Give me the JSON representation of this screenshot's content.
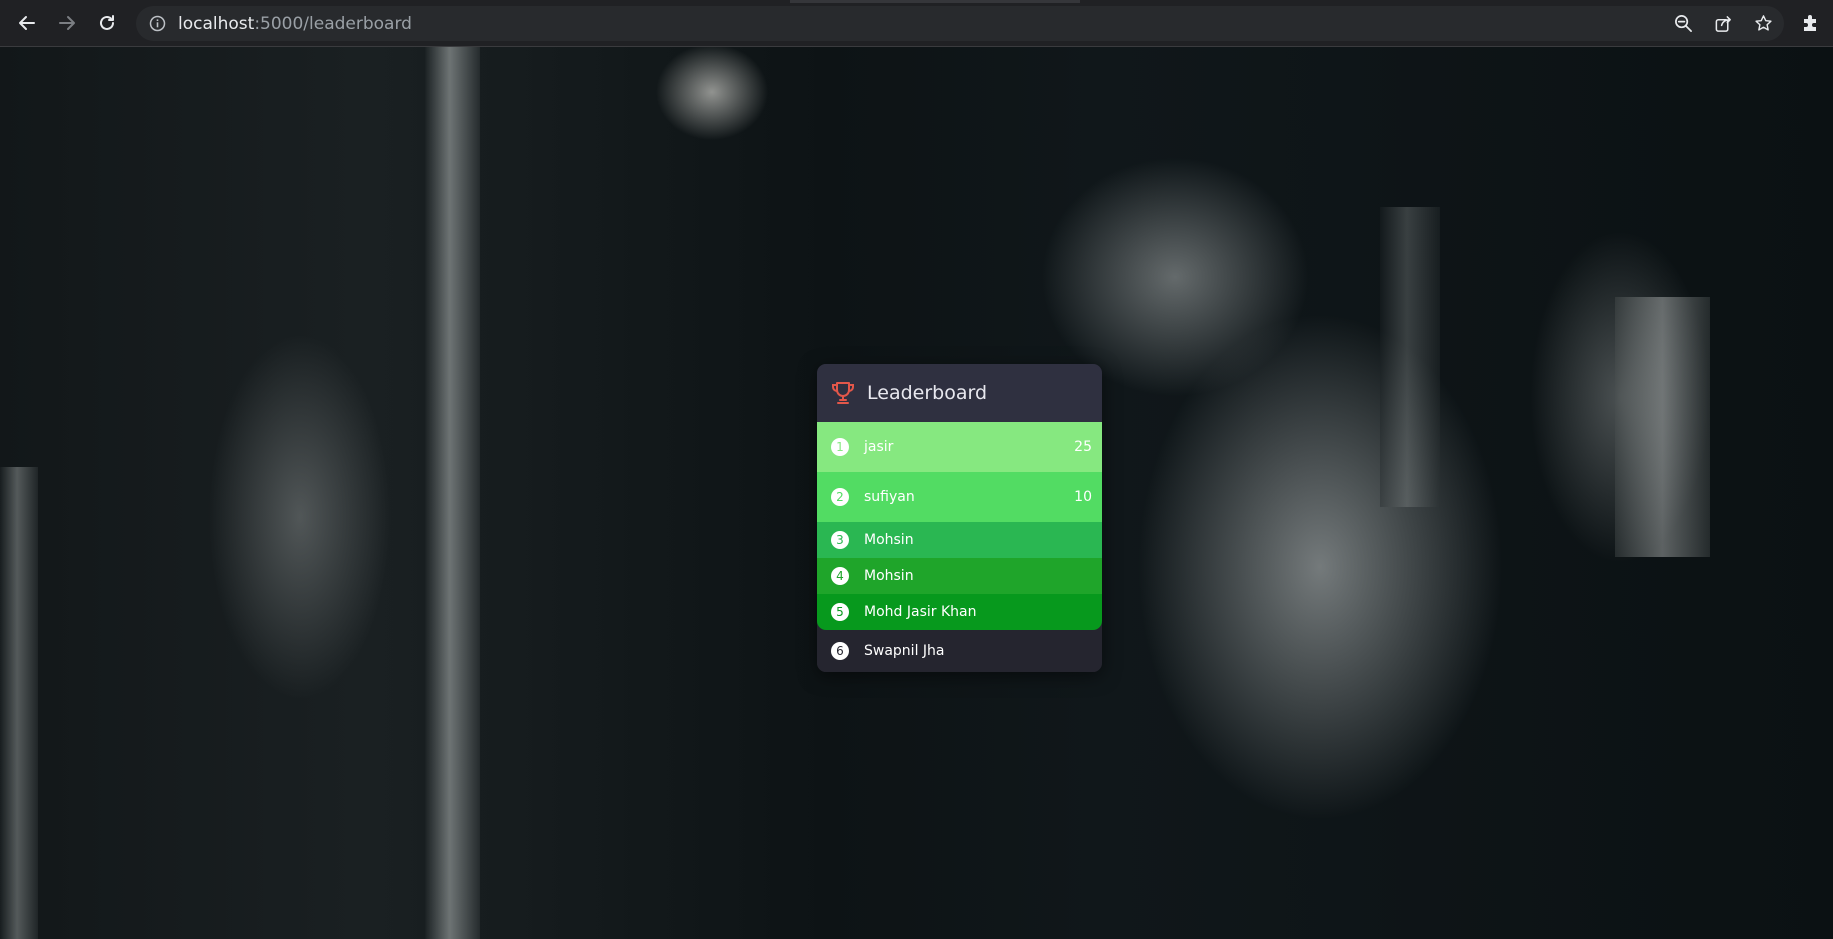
{
  "browser": {
    "url_host": "localhost",
    "url_rest": ":5000/leaderboard"
  },
  "leaderboard": {
    "title": "Leaderboard",
    "entries": [
      {
        "rank": "1",
        "name": "jasir",
        "score": "25",
        "color": "#86e880",
        "rank_color": "#86e880"
      },
      {
        "rank": "2",
        "name": "sufiyan",
        "score": "10",
        "color": "#52dc63",
        "rank_color": "#52dc63"
      },
      {
        "rank": "3",
        "name": "Mohsin",
        "score": "",
        "color": "#2ab752",
        "rank_color": "#2ab752"
      },
      {
        "rank": "4",
        "name": "Mohsin",
        "score": "",
        "color": "#1fa52a",
        "rank_color": "#1fa52a"
      },
      {
        "rank": "5",
        "name": "Mohd Jasir Khan",
        "score": "",
        "color": "#07991d",
        "rank_color": "#07991d"
      },
      {
        "rank": "6",
        "name": "Swapnil Jha",
        "score": "",
        "color": "#25252f",
        "rank_color": "#25252f"
      }
    ]
  },
  "icons": {
    "back": "arrow-left-icon",
    "forward": "arrow-right-icon",
    "reload": "reload-icon",
    "info": "info-icon",
    "zoom": "zoom-out-icon",
    "share": "share-icon",
    "bookmark": "star-icon",
    "extensions": "puzzle-icon",
    "trophy": "trophy-icon"
  },
  "colors": {
    "trophy": "#e3574a",
    "chrome_bg": "#202124",
    "card_header": "#2f3040"
  }
}
